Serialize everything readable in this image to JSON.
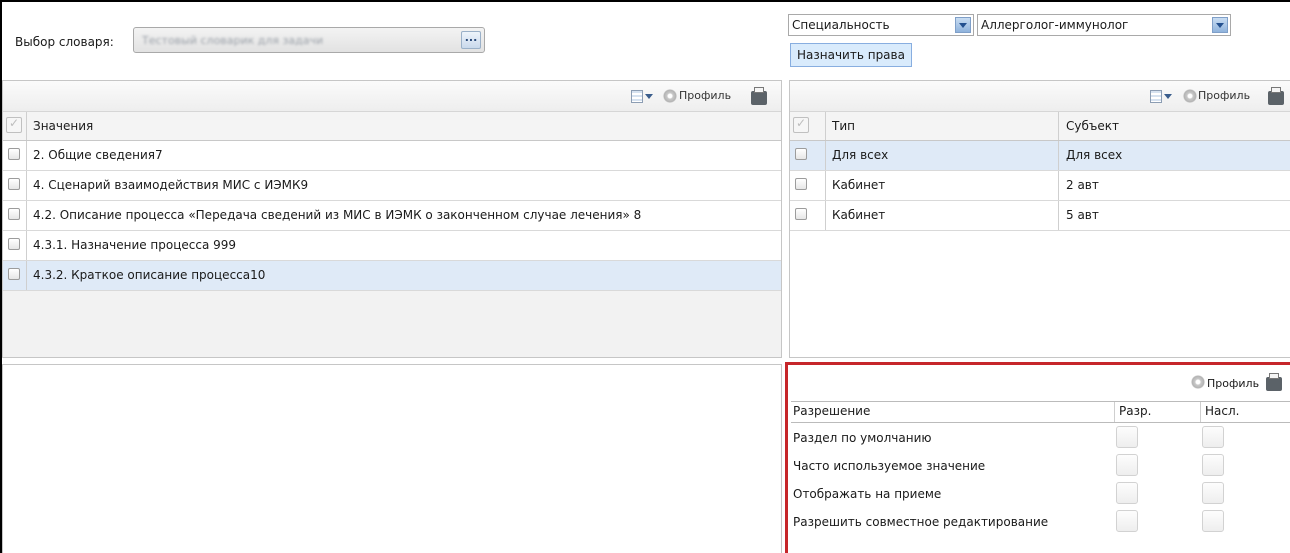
{
  "dictionary": {
    "label": "Выбор словаря:",
    "value": "Тестовый словарик для задачи",
    "browse_label": "..."
  },
  "filters": {
    "type_value": "Специальность",
    "subject_value": "Аллерголог-иммунолог",
    "assign_label": "Назначить права"
  },
  "toolbar": {
    "profile_label": "Профиль"
  },
  "values_grid": {
    "header": "Значения",
    "rows": [
      {
        "label": "2. Общие сведения7",
        "selected": false
      },
      {
        "label": "4. Сценарий взаимодействия МИС с ИЭМК9",
        "selected": false
      },
      {
        "label": "4.2. Описание процесса «Передача сведений из МИС в ИЭМК о законченном случае лечения» 8",
        "selected": false
      },
      {
        "label": "4.3.1. Назначение процесса 999",
        "selected": false
      },
      {
        "label": "4.3.2. Краткое описание процесса10",
        "selected": true
      }
    ]
  },
  "rights_grid": {
    "headers": [
      "Тип",
      "Субъект"
    ],
    "rows": [
      {
        "type": "Для всех",
        "subject": "Для всех",
        "selected": true
      },
      {
        "type": "Кабинет",
        "subject": "2 авт",
        "selected": false
      },
      {
        "type": "Кабинет",
        "subject": "5 авт",
        "selected": false
      }
    ]
  },
  "permissions": {
    "headers": [
      "Разрешение",
      "Разр.",
      "Насл."
    ],
    "rows": [
      "Раздел по умолчанию",
      "Часто используемое значение",
      "Отображать на приеме",
      "Разрешить совместное редактирование"
    ]
  },
  "colors": {
    "highlight_border": "#c6262a",
    "selected_row": "#dfeaf7",
    "button_bg": "#d9ebfc"
  }
}
